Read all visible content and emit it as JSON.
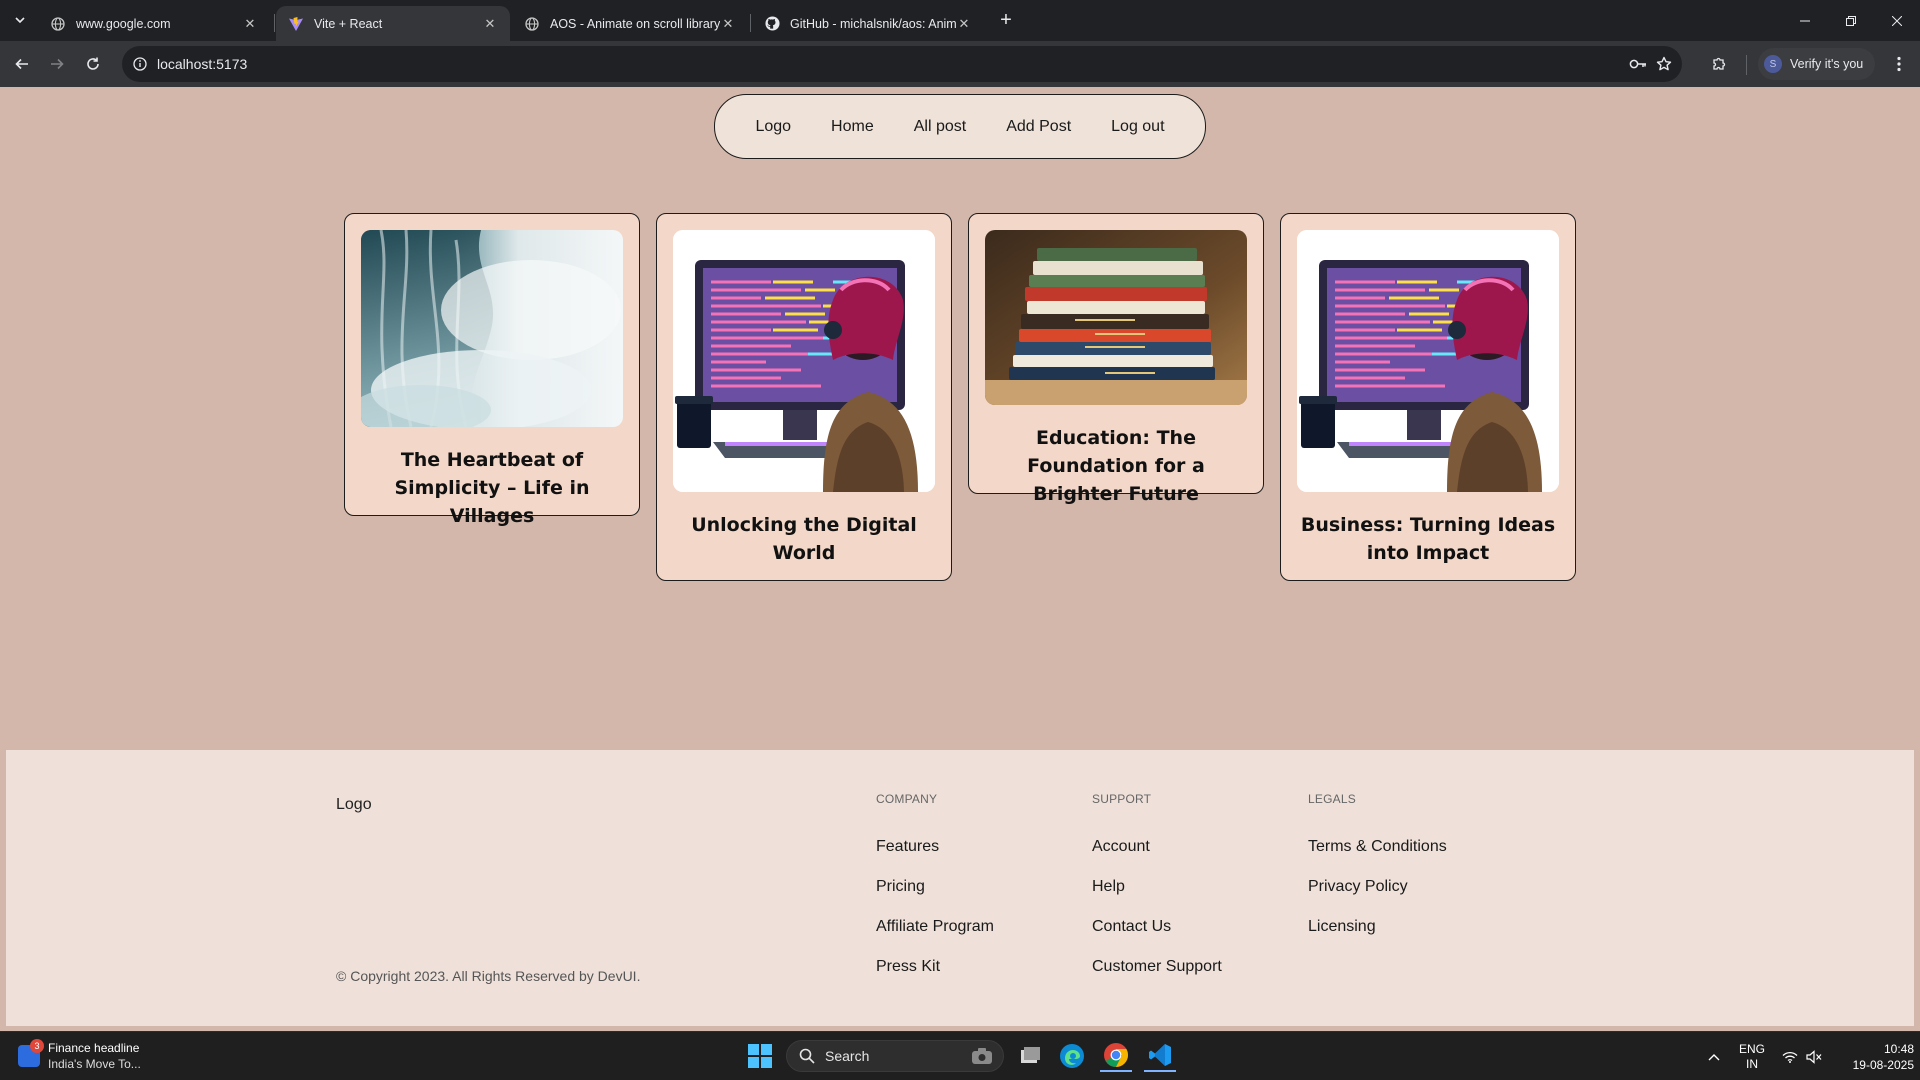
{
  "browser": {
    "tabs": [
      {
        "title": "www.google.com",
        "icon": "globe-icon"
      },
      {
        "title": "Vite + React",
        "icon": "vite-icon"
      },
      {
        "title": "AOS - Animate on scroll library",
        "icon": "globe-icon"
      },
      {
        "title": "GitHub - michalsnik/aos: Anima",
        "icon": "github-icon"
      }
    ],
    "url": "localhost:5173",
    "profile_label": "Verify it's you",
    "profile_initial": "S"
  },
  "nav": {
    "items": [
      "Logo",
      "Home",
      "All post",
      "Add Post",
      "Log out"
    ]
  },
  "posts": [
    {
      "title": "The Heartbeat of Simplicity – Life in Villages",
      "image": "waterfall"
    },
    {
      "title": "Unlocking the Digital World",
      "image": "coder-illustration"
    },
    {
      "title": "Education: The Foundation for a Brighter Future",
      "image": "books-stack"
    },
    {
      "title": "Business: Turning Ideas into Impact",
      "image": "coder-illustration"
    }
  ],
  "footer": {
    "logo": "Logo",
    "copyright": "© Copyright 2023. All Rights Reserved by DevUI.",
    "columns": [
      {
        "heading": "COMPANY",
        "links": [
          "Features",
          "Pricing",
          "Affiliate Program",
          "Press Kit"
        ]
      },
      {
        "heading": "SUPPORT",
        "links": [
          "Account",
          "Help",
          "Contact Us",
          "Customer Support"
        ]
      },
      {
        "heading": "LEGALS",
        "links": [
          "Terms & Conditions",
          "Privacy Policy",
          "Licensing"
        ]
      }
    ]
  },
  "taskbar": {
    "news_title": "Finance headline",
    "news_sub": "India's Move To...",
    "news_badge": "3",
    "search_label": "Search",
    "lang_top": "ENG",
    "lang_bottom": "IN",
    "time": "10:48",
    "date": "19-08-2025"
  },
  "colors": {
    "page_bg": "#d3b7aa",
    "card_bg": "#f3d7c8",
    "footer_bg": "#efe1d9",
    "nav_bg": "#efe2d9"
  }
}
